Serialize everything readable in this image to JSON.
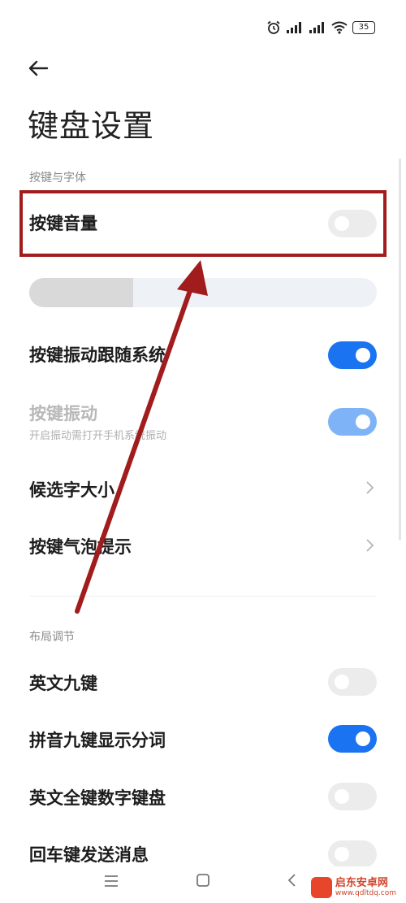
{
  "status_bar": {
    "battery": "35"
  },
  "page": {
    "title": "键盘设置"
  },
  "sections": {
    "keys_fonts": "按键与字体",
    "layout": "布局调节"
  },
  "settings": {
    "key_volume": {
      "label": "按键音量",
      "enabled": false
    },
    "volume_slider": {
      "level_fraction": 0.3
    },
    "vibration_follow_system": {
      "label": "按键振动跟随系统",
      "enabled": true
    },
    "key_vibration": {
      "label": "按键振动",
      "subtitle": "开启振动需打开手机系统振动",
      "enabled": true,
      "disabled_state": true
    },
    "candidate_font_size": {
      "label": "候选字大小"
    },
    "key_bubble_hint": {
      "label": "按键气泡提示"
    },
    "english_nine_key": {
      "label": "英文九键",
      "enabled": false
    },
    "pinyin_nine_key_segmentation": {
      "label": "拼音九键显示分词",
      "enabled": true
    },
    "english_full_key_numpad": {
      "label": "英文全键数字键盘",
      "enabled": false
    },
    "enter_send_message": {
      "label": "回车键发送消息",
      "enabled": false
    }
  },
  "colors": {
    "accent": "#1a73f0",
    "annotation": "#a11c1c"
  },
  "watermark": {
    "name": "启东安卓网",
    "url": "www.qdltdq.com"
  }
}
